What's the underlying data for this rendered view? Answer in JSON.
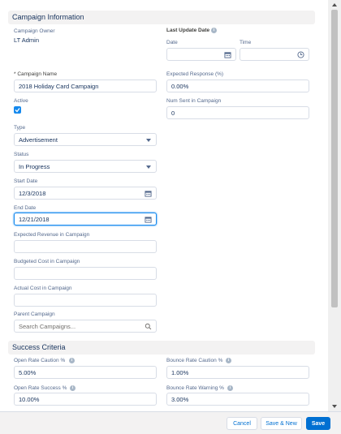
{
  "sections": {
    "campaign_information": "Campaign Information",
    "success_criteria": "Success Criteria"
  },
  "fields": {
    "campaign_owner": {
      "label": "Campaign Owner",
      "value": "LT Admin"
    },
    "last_update_date": {
      "label": "Last Update Date"
    },
    "date": {
      "label": "Date",
      "value": ""
    },
    "time": {
      "label": "Time",
      "value": ""
    },
    "campaign_name": {
      "label": "* Campaign Name",
      "value": "2018 Holiday Card Campaign"
    },
    "expected_response": {
      "label": "Expected Response (%)",
      "value": "0.00%"
    },
    "active": {
      "label": "Active",
      "checked": true
    },
    "num_sent": {
      "label": "Num Sent in Campaign",
      "value": "0"
    },
    "type": {
      "label": "Type",
      "value": "Advertisement"
    },
    "status": {
      "label": "Status",
      "value": "In Progress"
    },
    "start_date": {
      "label": "Start Date",
      "value": "12/3/2018"
    },
    "end_date": {
      "label": "End Date",
      "value": "12/21/2018"
    },
    "expected_revenue": {
      "label": "Expected Revenue in Campaign",
      "value": ""
    },
    "budgeted_cost": {
      "label": "Budgeted Cost in Campaign",
      "value": ""
    },
    "actual_cost": {
      "label": "Actual Cost in Campaign",
      "value": ""
    },
    "parent_campaign": {
      "label": "Parent Campaign",
      "placeholder": "Search Campaigns..."
    },
    "open_rate_caution": {
      "label": "Open Rate Caution %",
      "value": "5.00%"
    },
    "bounce_rate_caution": {
      "label": "Bounce Rate Caution %",
      "value": "1.00%"
    },
    "open_rate_success": {
      "label": "Open Rate Success %",
      "value": "10.00%"
    },
    "bounce_rate_warning": {
      "label": "Bounce Rate Warning %",
      "value": "3.00%"
    }
  },
  "footer": {
    "cancel_label": "Cancel",
    "save_new_label": "Save & New",
    "save_label": "Save"
  },
  "colors": {
    "brand": "#0070d2",
    "checkbox": "#1589ee",
    "section_bg": "#f3f2f2"
  }
}
